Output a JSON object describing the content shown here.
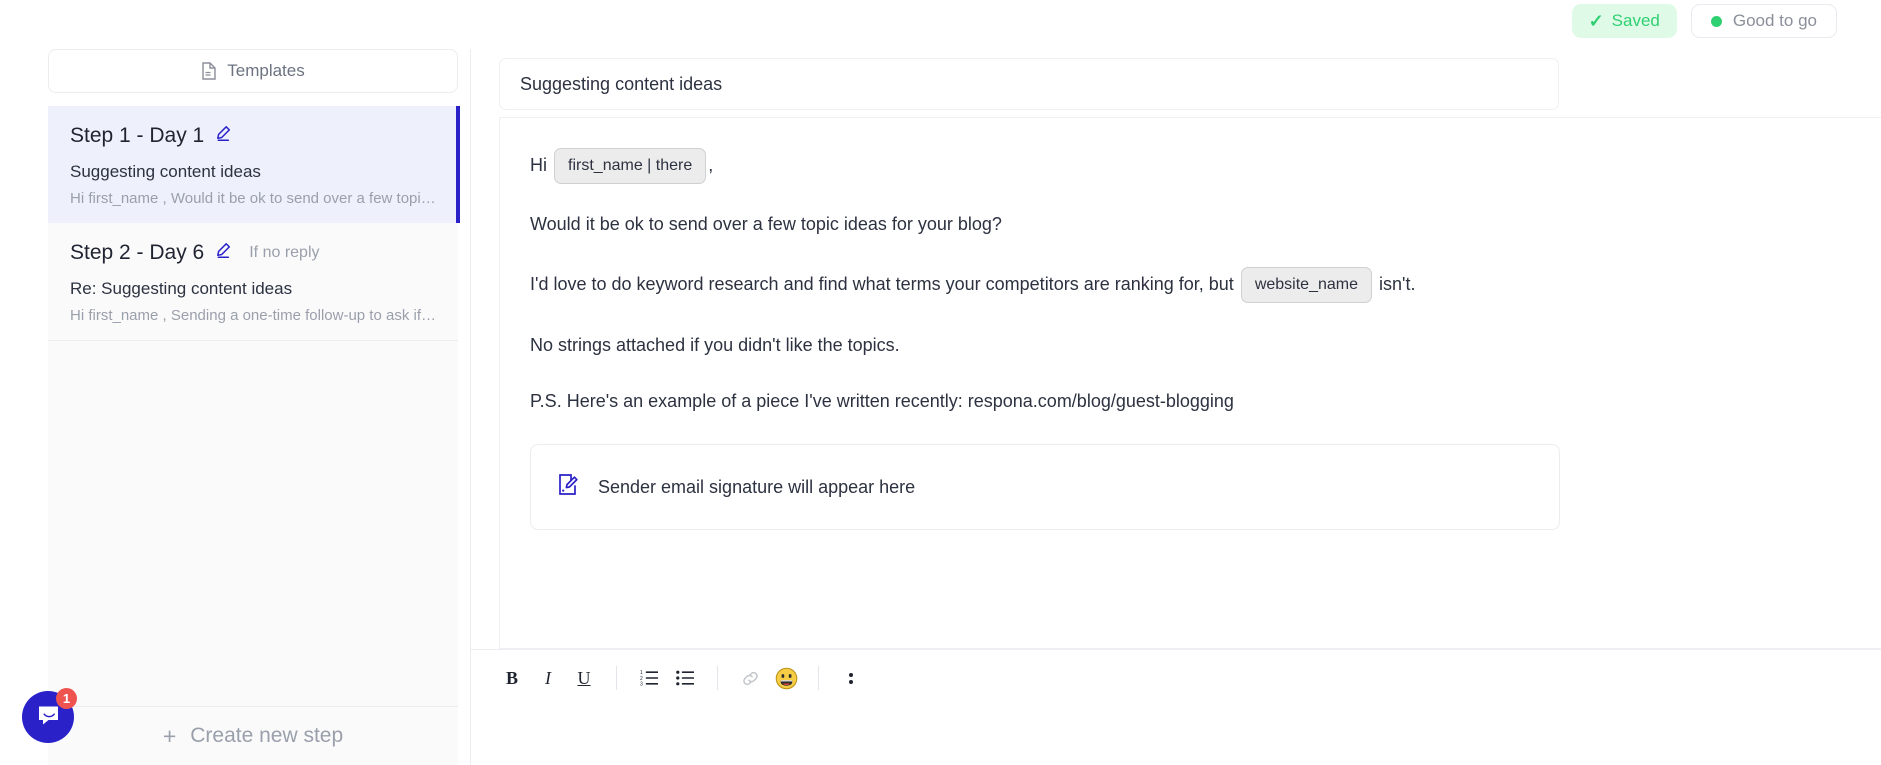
{
  "topbar": {
    "saved_label": "Saved",
    "saved_icon": "check-icon",
    "saved_color": "#2fd071",
    "saved_bg": "#dffbe8",
    "status_label": "Good to go",
    "status_dot_color": "#2fd071"
  },
  "sidebar": {
    "templates_label": "Templates",
    "templates_icon": "template-file-icon",
    "create_step_label": "Create new step",
    "create_step_plus": "+",
    "steps": [
      {
        "title": "Step 1 - Day 1",
        "condition": "",
        "subject": "Suggesting content ideas",
        "preview": "Hi first_name , Would it be ok to send over a few topic ideas ...",
        "active": true
      },
      {
        "title": "Step 2 - Day 6",
        "condition": "If no reply",
        "subject": "Re: Suggesting content ideas",
        "preview": "Hi first_name , Sending a one-time follow-up to ask if you're ...",
        "active": false
      }
    ]
  },
  "editor": {
    "subject": "Suggesting content ideas",
    "variable_button_label": "{ }",
    "greeting_prefix": "Hi",
    "greeting_variable": "first_name | there",
    "greeting_suffix": ",",
    "paragraph_2": "Would it be ok to send over a few topic ideas for your blog?",
    "paragraph_3_before": "I'd love to do keyword research and find what terms your competitors are ranking for, but",
    "paragraph_3_variable": "website_name",
    "paragraph_3_after": "isn't.",
    "paragraph_4": "No strings attached if you didn't like the topics.",
    "paragraph_5": "P.S. Here's an example of a piece I've written recently: respona.com/blog/guest-blogging",
    "signature_placeholder": "Sender email signature will appear here",
    "signature_icon": "signature-edit-icon"
  },
  "toolbar": {
    "bold_label": "B",
    "italic_label": "I",
    "underline_label": "U",
    "ordered_list_icon": "ordered-list-icon",
    "bullet_list_icon": "bullet-list-icon",
    "link_icon": "link-icon",
    "emoji_icon": "emoji-smiley-icon",
    "emoji_glyph": "😀",
    "more_icon": "more-vertical-icon"
  },
  "chat_widget": {
    "icon": "intercom-chat-icon",
    "badge_count": "1",
    "color": "#2a21c9",
    "badge_color": "#ef5350"
  }
}
